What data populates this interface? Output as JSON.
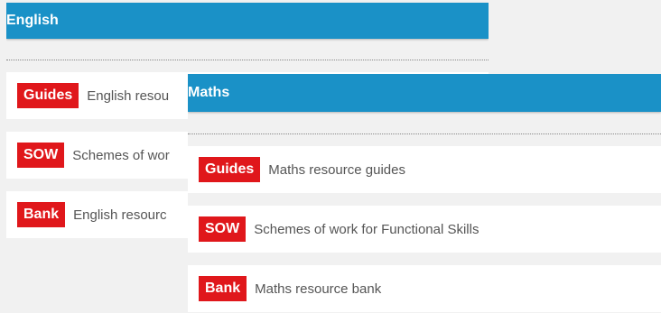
{
  "english": {
    "title": "English",
    "items": [
      {
        "badge": "Guides",
        "label": "English resou"
      },
      {
        "badge": "SOW",
        "label": "Schemes of wor"
      },
      {
        "badge": "Bank",
        "label": "English resourc"
      }
    ]
  },
  "maths": {
    "title": "Maths",
    "items": [
      {
        "badge": "Guides",
        "label": "Maths resource guides"
      },
      {
        "badge": "SOW",
        "label": "Schemes of work for Functional Skills"
      },
      {
        "badge": "Bank",
        "label": "Maths resource bank"
      }
    ]
  },
  "colors": {
    "header_bg": "#1a91c7",
    "badge_bg": "#e0171b",
    "page_bg": "#f1f1f1"
  }
}
